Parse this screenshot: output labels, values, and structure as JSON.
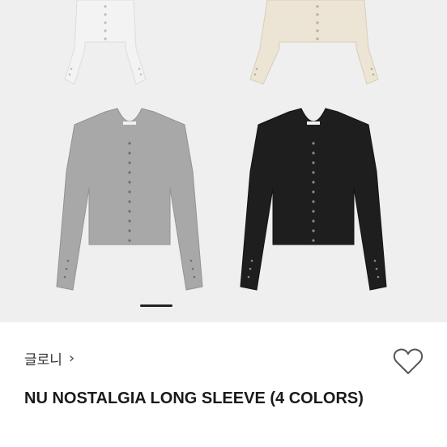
{
  "brand": {
    "name": "글로니",
    "chevron": "›"
  },
  "product": {
    "title": "NU NOSTALGIA LONG SLEEVE (4 COLORS)"
  },
  "gallery": {
    "colors": [
      {
        "name": "white",
        "hex": "#f3f3f3"
      },
      {
        "name": "ivory",
        "hex": "#ece4d4"
      },
      {
        "name": "gray",
        "hex": "#a8a8a8"
      },
      {
        "name": "black",
        "hex": "#1e1e1e"
      }
    ],
    "pager_active_index": 0
  },
  "icons": {
    "like": "heart-outline-icon",
    "brand_link": "chevron-right-icon"
  }
}
